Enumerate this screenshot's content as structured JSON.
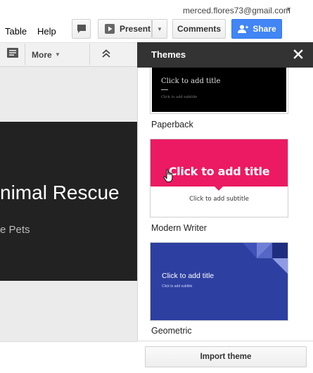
{
  "account": {
    "email": "merced.flores73@gmail.com"
  },
  "menu": {
    "items": [
      "Table",
      "Help"
    ]
  },
  "toolbar": {
    "present_label": "Present",
    "comments_label": "Comments",
    "share_label": "Share",
    "more_label": "More"
  },
  "slide": {
    "title_fragment": "nimal Rescue",
    "subtitle_fragment": "e Pets"
  },
  "themes_panel": {
    "title": "Themes",
    "themes": [
      {
        "name": "Paperback",
        "preview_title": "Click to add title",
        "preview_subtitle": "Click to add subtitle",
        "bg": "#000000"
      },
      {
        "name": "Modern Writer",
        "preview_title": "Click to add title",
        "preview_subtitle": "Click to add subtitle",
        "accent": "#ec1a62"
      },
      {
        "name": "Geometric",
        "preview_title": "Click to add title",
        "preview_subtitle": "Click to add subtitle",
        "bg": "#2d3fa0"
      }
    ],
    "import_label": "Import theme"
  },
  "icons": {
    "comment": "comment-icon",
    "present": "play-icon",
    "share": "person-add-icon",
    "speaker_notes": "speaker-notes-icon",
    "collapse": "chevron-up-double-icon",
    "close": "close-icon",
    "cursor": "hand-cursor-icon"
  },
  "colors": {
    "share_blue": "#4285f4",
    "panel_header": "#333333",
    "slide_bg": "#222222"
  }
}
